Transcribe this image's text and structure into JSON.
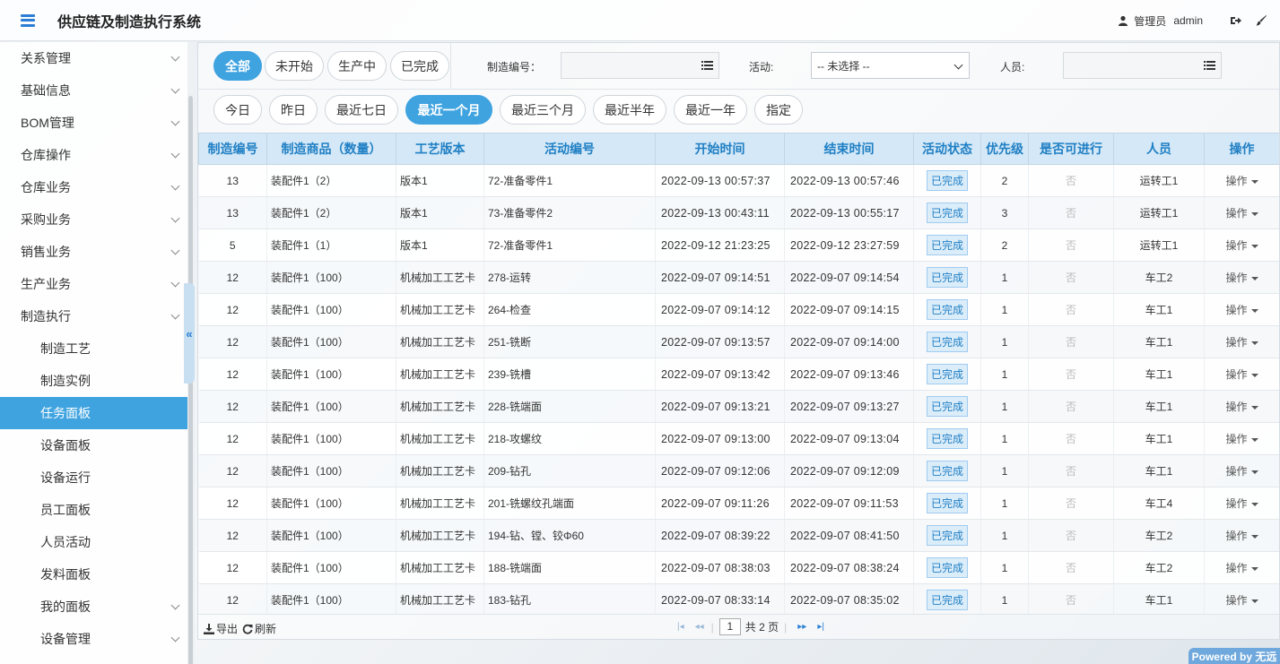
{
  "header": {
    "app_title": "供应链及制造执行系统",
    "user_role": "管理员",
    "user_name": "admin"
  },
  "sidebar": {
    "items": [
      {
        "label": "关系管理",
        "sub": false,
        "chevron": true,
        "active": false
      },
      {
        "label": "基础信息",
        "sub": false,
        "chevron": true,
        "active": false
      },
      {
        "label": "BOM管理",
        "sub": false,
        "chevron": true,
        "active": false
      },
      {
        "label": "仓库操作",
        "sub": false,
        "chevron": true,
        "active": false
      },
      {
        "label": "仓库业务",
        "sub": false,
        "chevron": true,
        "active": false
      },
      {
        "label": "采购业务",
        "sub": false,
        "chevron": true,
        "active": false
      },
      {
        "label": "销售业务",
        "sub": false,
        "chevron": true,
        "active": false
      },
      {
        "label": "生产业务",
        "sub": false,
        "chevron": true,
        "active": false
      },
      {
        "label": "制造执行",
        "sub": false,
        "chevron": true,
        "active": false
      },
      {
        "label": "制造工艺",
        "sub": true,
        "chevron": false,
        "active": false
      },
      {
        "label": "制造实例",
        "sub": true,
        "chevron": false,
        "active": false
      },
      {
        "label": "任务面板",
        "sub": true,
        "chevron": false,
        "active": true
      },
      {
        "label": "设备面板",
        "sub": true,
        "chevron": false,
        "active": false
      },
      {
        "label": "设备运行",
        "sub": true,
        "chevron": false,
        "active": false
      },
      {
        "label": "员工面板",
        "sub": true,
        "chevron": false,
        "active": false
      },
      {
        "label": "人员活动",
        "sub": true,
        "chevron": false,
        "active": false
      },
      {
        "label": "发料面板",
        "sub": true,
        "chevron": false,
        "active": false
      },
      {
        "label": "我的面板",
        "sub": true,
        "chevron": true,
        "active": false
      },
      {
        "label": "设备管理",
        "sub": true,
        "chevron": true,
        "active": false
      }
    ],
    "collapse_glyph": "«"
  },
  "filters": {
    "status_tabs": [
      {
        "label": "全部",
        "active": true
      },
      {
        "label": "未开始",
        "active": false
      },
      {
        "label": "生产中",
        "active": false
      },
      {
        "label": "已完成",
        "active": false
      }
    ],
    "mfg_no_label": "制造编号：",
    "activity_label": "活动:",
    "activity_value": "-- 未选择 --",
    "person_label": "人员:",
    "time_tabs": [
      {
        "label": "今日",
        "active": false
      },
      {
        "label": "昨日",
        "active": false
      },
      {
        "label": "最近七日",
        "active": false
      },
      {
        "label": "最近一个月",
        "active": true
      },
      {
        "label": "最近三个月",
        "active": false
      },
      {
        "label": "最近半年",
        "active": false
      },
      {
        "label": "最近一年",
        "active": false
      },
      {
        "label": "指定",
        "active": false
      }
    ]
  },
  "table": {
    "columns": [
      "制造编号",
      "制造商品（数量）",
      "工艺版本",
      "活动编号",
      "开始时间",
      "结束时间",
      "活动状态",
      "优先级",
      "是否可进行",
      "人员",
      "操作"
    ],
    "rows": [
      {
        "no": "13",
        "product": "装配件1（2）",
        "version": "版本1",
        "activity": "72-准备零件1",
        "start": "2022-09-13 00:57:37",
        "end": "2022-09-13 00:57:46",
        "status": "已完成",
        "priority": "2",
        "runnable": "否",
        "person": "运转工1",
        "op": "操作"
      },
      {
        "no": "13",
        "product": "装配件1（2）",
        "version": "版本1",
        "activity": "73-准备零件2",
        "start": "2022-09-13 00:43:11",
        "end": "2022-09-13 00:55:17",
        "status": "已完成",
        "priority": "3",
        "runnable": "否",
        "person": "运转工1",
        "op": "操作"
      },
      {
        "no": "5",
        "product": "装配件1（1）",
        "version": "版本1",
        "activity": "72-准备零件1",
        "start": "2022-09-12 21:23:25",
        "end": "2022-09-12 23:27:59",
        "status": "已完成",
        "priority": "2",
        "runnable": "否",
        "person": "运转工1",
        "op": "操作"
      },
      {
        "no": "12",
        "product": "装配件1（100）",
        "version": "机械加工工艺卡",
        "activity": "278-运转",
        "start": "2022-09-07 09:14:51",
        "end": "2022-09-07 09:14:54",
        "status": "已完成",
        "priority": "1",
        "runnable": "否",
        "person": "车工2",
        "op": "操作"
      },
      {
        "no": "12",
        "product": "装配件1（100）",
        "version": "机械加工工艺卡",
        "activity": "264-检查",
        "start": "2022-09-07 09:14:12",
        "end": "2022-09-07 09:14:15",
        "status": "已完成",
        "priority": "1",
        "runnable": "否",
        "person": "车工1",
        "op": "操作"
      },
      {
        "no": "12",
        "product": "装配件1（100）",
        "version": "机械加工工艺卡",
        "activity": "251-铣断",
        "start": "2022-09-07 09:13:57",
        "end": "2022-09-07 09:14:00",
        "status": "已完成",
        "priority": "1",
        "runnable": "否",
        "person": "车工1",
        "op": "操作"
      },
      {
        "no": "12",
        "product": "装配件1（100）",
        "version": "机械加工工艺卡",
        "activity": "239-铣槽",
        "start": "2022-09-07 09:13:42",
        "end": "2022-09-07 09:13:46",
        "status": "已完成",
        "priority": "1",
        "runnable": "否",
        "person": "车工1",
        "op": "操作"
      },
      {
        "no": "12",
        "product": "装配件1（100）",
        "version": "机械加工工艺卡",
        "activity": "228-铣端面",
        "start": "2022-09-07 09:13:21",
        "end": "2022-09-07 09:13:27",
        "status": "已完成",
        "priority": "1",
        "runnable": "否",
        "person": "车工1",
        "op": "操作"
      },
      {
        "no": "12",
        "product": "装配件1（100）",
        "version": "机械加工工艺卡",
        "activity": "218-攻螺纹",
        "start": "2022-09-07 09:13:00",
        "end": "2022-09-07 09:13:04",
        "status": "已完成",
        "priority": "1",
        "runnable": "否",
        "person": "车工1",
        "op": "操作"
      },
      {
        "no": "12",
        "product": "装配件1（100）",
        "version": "机械加工工艺卡",
        "activity": "209-钻孔",
        "start": "2022-09-07 09:12:06",
        "end": "2022-09-07 09:12:09",
        "status": "已完成",
        "priority": "1",
        "runnable": "否",
        "person": "车工1",
        "op": "操作"
      },
      {
        "no": "12",
        "product": "装配件1（100）",
        "version": "机械加工工艺卡",
        "activity": "201-铣螺纹孔端面",
        "start": "2022-09-07 09:11:26",
        "end": "2022-09-07 09:11:53",
        "status": "已完成",
        "priority": "1",
        "runnable": "否",
        "person": "车工4",
        "op": "操作"
      },
      {
        "no": "12",
        "product": "装配件1（100）",
        "version": "机械加工工艺卡",
        "activity": "194-钻、镗、铰Φ60",
        "start": "2022-09-07 08:39:22",
        "end": "2022-09-07 08:41:50",
        "status": "已完成",
        "priority": "1",
        "runnable": "否",
        "person": "车工2",
        "op": "操作"
      },
      {
        "no": "12",
        "product": "装配件1（100）",
        "version": "机械加工工艺卡",
        "activity": "188-铣端面",
        "start": "2022-09-07 08:38:03",
        "end": "2022-09-07 08:38:24",
        "status": "已完成",
        "priority": "1",
        "runnable": "否",
        "person": "车工2",
        "op": "操作"
      },
      {
        "no": "12",
        "product": "装配件1（100）",
        "version": "机械加工工艺卡",
        "activity": "183-钻孔",
        "start": "2022-09-07 08:33:14",
        "end": "2022-09-07 08:35:02",
        "status": "已完成",
        "priority": "1",
        "runnable": "否",
        "person": "车工1",
        "op": "操作"
      }
    ]
  },
  "footer": {
    "export_label": "导出",
    "refresh_label": "刷新",
    "current_page": "1",
    "total_pages_text": "共 2 页"
  },
  "powered_by": "Powered by 无远",
  "colors": {
    "accent": "#3fa3e0",
    "header_text": "#1f7fc4",
    "header_bg": "#d4e8f7"
  }
}
